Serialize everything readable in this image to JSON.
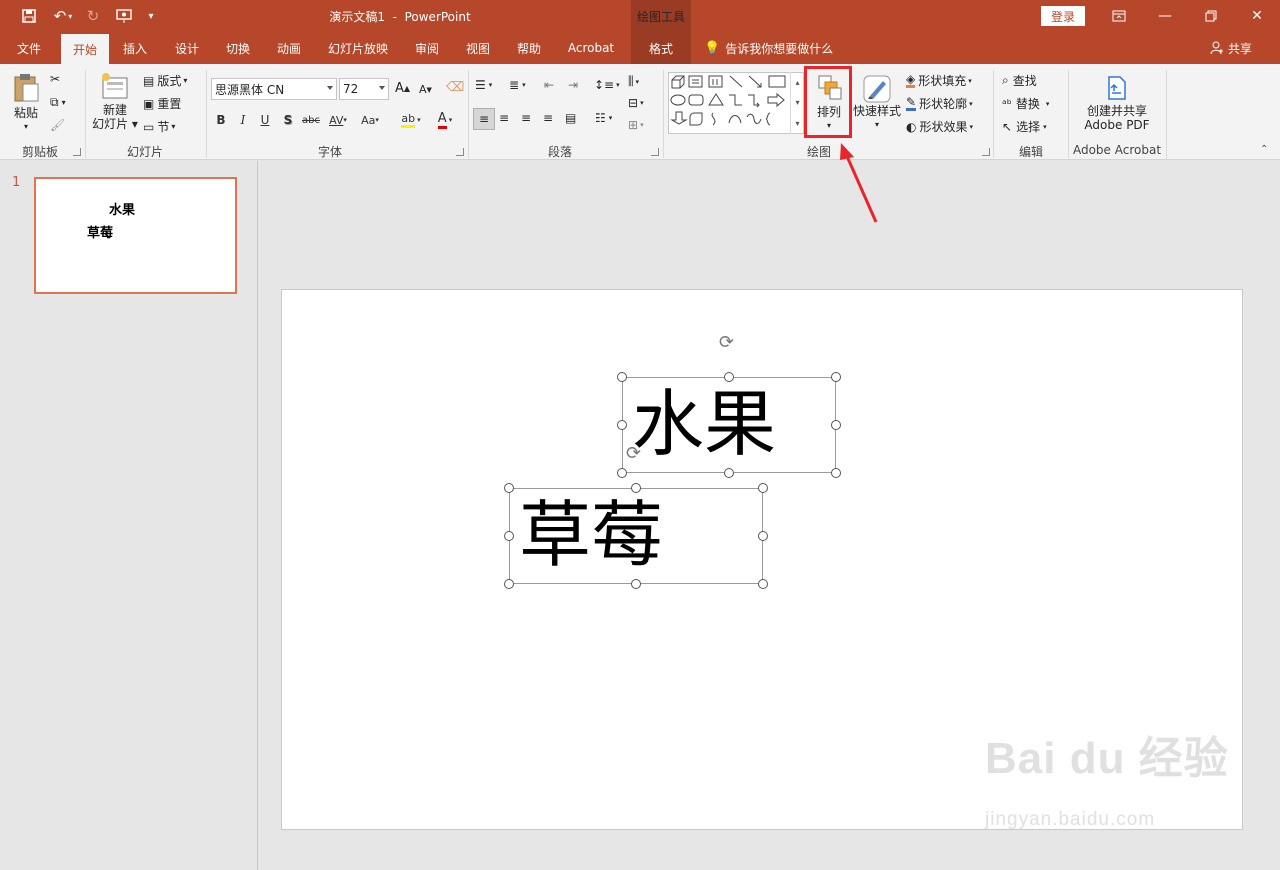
{
  "titlebar": {
    "doc_title": "演示文稿1",
    "separator": "-",
    "app_name": "PowerPoint",
    "context_group": "绘图工具",
    "login_label": "登录"
  },
  "tabs": [
    "文件",
    "开始",
    "插入",
    "设计",
    "切换",
    "动画",
    "幻灯片放映",
    "审阅",
    "视图",
    "帮助",
    "Acrobat",
    "格式"
  ],
  "active_tab": "开始",
  "tell_me": "告诉我你想要做什么",
  "share_label": "共享",
  "ribbon": {
    "clipboard": {
      "paste": "粘贴",
      "group": "剪贴板"
    },
    "slides": {
      "new_slide_line1": "新建",
      "new_slide_line2": "幻灯片",
      "layout": "版式",
      "reset": "重置",
      "section": "节",
      "group": "幻灯片"
    },
    "font": {
      "font_name": "思源黑体 CN",
      "font_size": "72",
      "bold": "B",
      "italic": "I",
      "underline": "U",
      "shadow": "S",
      "strike": "abc",
      "spacing": "AV",
      "case": "Aa",
      "grow": "A",
      "shrink": "A",
      "color_a": "A",
      "group": "字体"
    },
    "paragraph": {
      "group": "段落"
    },
    "drawing": {
      "arrange": "排列",
      "quick_styles": "快速样式",
      "fill": "形状填充",
      "outline": "形状轮廓",
      "effects": "形状效果",
      "group": "绘图"
    },
    "editing": {
      "find": "查找",
      "replace": "替换",
      "select": "选择",
      "group": "编辑"
    },
    "acrobat": {
      "line1": "创建并共享",
      "line2": "Adobe PDF",
      "group": "Adobe Acrobat"
    }
  },
  "thumbnail": {
    "number": "1",
    "text1": "水果",
    "text2": "草莓"
  },
  "slide": {
    "text1": "水果",
    "text2": "草莓"
  },
  "watermark": {
    "logo": "Bai du 经验",
    "url": "jingyan.baidu.com"
  },
  "colors": {
    "brand": "#b7472a",
    "highlight": "#e8252a"
  }
}
